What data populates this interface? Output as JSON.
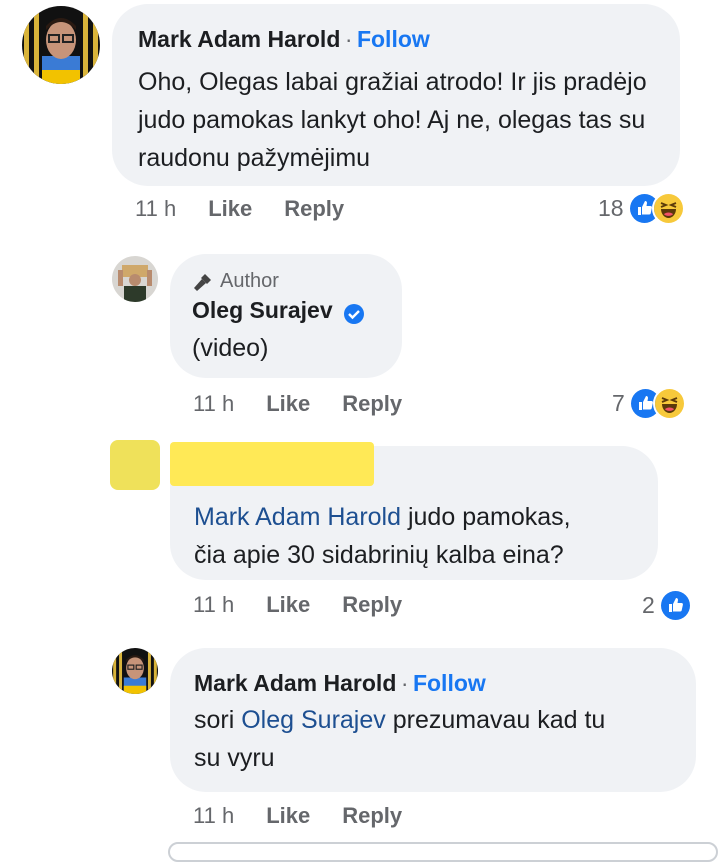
{
  "comments": [
    {
      "author": "Mark Adam Harold",
      "separator": "·",
      "follow": "Follow",
      "text": "Oho, Olegas labai gražiai atrodo! Ir jis pradėjo judo pamokas lankyt oho! Aj ne, olegas tas su raudonu pažymėjimu",
      "time": "11 h",
      "like": "Like",
      "reply": "Reply",
      "reaction_count": "18",
      "reactions": [
        "like-icon",
        "haha-icon"
      ]
    },
    {
      "author_tag": "Author",
      "author": "Oleg Surajev",
      "text": "(video)",
      "time": "11 h",
      "like": "Like",
      "reply": "Reply",
      "reaction_count": "7",
      "reactions": [
        "like-icon",
        "haha-icon"
      ]
    },
    {
      "author": "",
      "mention": "Mark Adam Harold",
      "text_after": " judo pamokas,",
      "text_line2": "čia apie 30 sidabrinių kalba eina?",
      "time": "11 h",
      "like": "Like",
      "reply": "Reply",
      "reaction_count": "2",
      "reactions": [
        "like-icon"
      ]
    },
    {
      "author": "Mark Adam Harold",
      "separator": "·",
      "follow": "Follow",
      "text_before": "sori ",
      "mention": "Oleg Surajev",
      "text_after": " prezumavau kad tu",
      "text_line2": "su vyru",
      "time": "11 h",
      "like": "Like",
      "reply": "Reply"
    }
  ],
  "colors": {
    "bubble": "#f0f2f5",
    "link": "#1877f2",
    "mention": "#1d4f91",
    "muted": "#65676b",
    "redaction": "#ffe84d"
  }
}
